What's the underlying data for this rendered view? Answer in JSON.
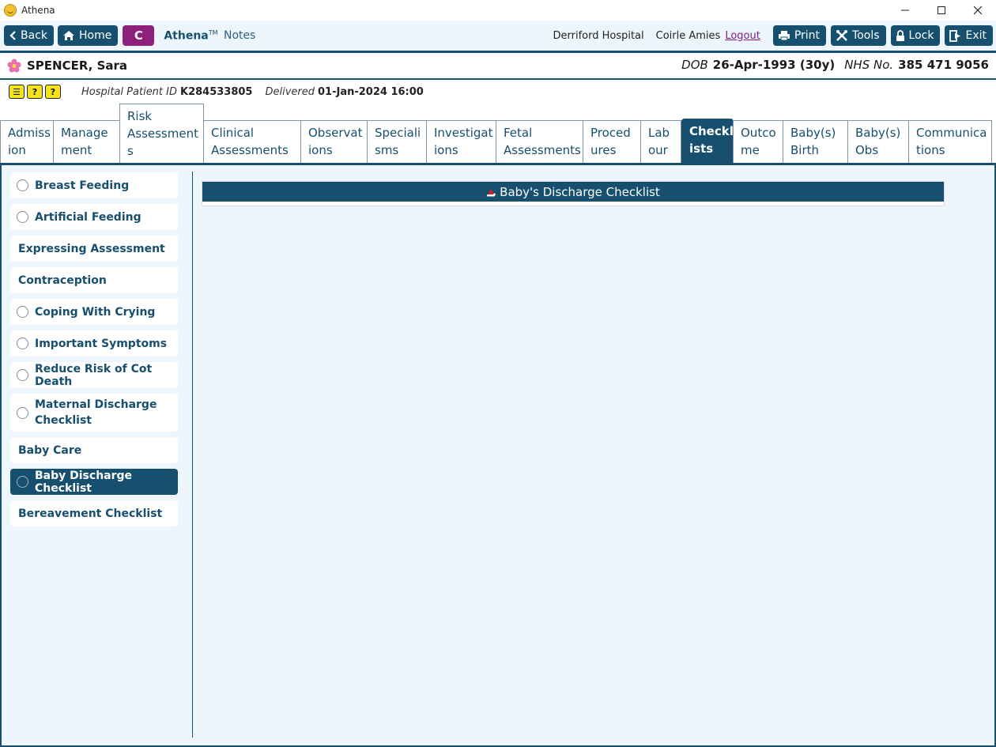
{
  "window": {
    "title": "Athena",
    "controls": [
      "—",
      "☐",
      "✕"
    ]
  },
  "toolbar": {
    "back": "Back",
    "home": "Home",
    "c": "C",
    "brand": "Athena",
    "brand_tm": "TM",
    "notes": "Notes",
    "hospital": "Derriford Hospital",
    "user": "Coirle Amies",
    "logout": "Logout",
    "print": "Print",
    "tools": "Tools",
    "lock": "Lock",
    "exit": "Exit"
  },
  "patient": {
    "name": "SPENCER, Sara",
    "dob_label": "DOB",
    "dob": "26-Apr-1993 (30y)",
    "nhs_label": "NHS No.",
    "nhs": "385 471 9056"
  },
  "info": {
    "alerts": [
      "☰",
      "?",
      "?"
    ],
    "hpid_label": "Hospital Patient ID",
    "hpid": "K284533805",
    "delivered_label": "Delivered",
    "delivered": "01-Jan-2024 16:00"
  },
  "tabs": [
    {
      "l1": "Admiss",
      "l2": "ion"
    },
    {
      "l1": "Manage",
      "l2": "ment"
    },
    {
      "l1": "Risk",
      "l2": "Assessment",
      "l3": "s"
    },
    {
      "l1": "Clinical",
      "l2": "Assessments"
    },
    {
      "l1": "Observat",
      "l2": "ions"
    },
    {
      "l1": "Speciali",
      "l2": "sms"
    },
    {
      "l1": "Investigat",
      "l2": "ions"
    },
    {
      "l1": "Fetal",
      "l2": "Assessments"
    },
    {
      "l1": "Proced",
      "l2": "ures"
    },
    {
      "l1": "Lab",
      "l2": "our"
    },
    {
      "l1": "Checkl",
      "l2": "ists"
    },
    {
      "l1": "Outco",
      "l2": "me"
    },
    {
      "l1": "Baby(s)",
      "l2": "Birth"
    },
    {
      "l1": "Baby(s)",
      "l2": "Obs"
    },
    {
      "l1": "Communica",
      "l2": "tions"
    }
  ],
  "sidebar": {
    "items": [
      {
        "label": "Breast Feeding"
      },
      {
        "label": "Artificial Feeding"
      },
      {
        "label": "Expressing Assessment"
      },
      {
        "label": "Contraception"
      },
      {
        "label": "Coping With Crying"
      },
      {
        "label": "Important Symptoms"
      },
      {
        "label": "Reduce Risk of Cot Death"
      },
      {
        "label": "Maternal Discharge",
        "label2": "Checklist"
      },
      {
        "label": "Baby Care"
      },
      {
        "label": "Baby Discharge Checklist"
      },
      {
        "label": "Bereavement Checklist"
      }
    ]
  },
  "panel": {
    "title": "Baby's Discharge Checklist"
  }
}
